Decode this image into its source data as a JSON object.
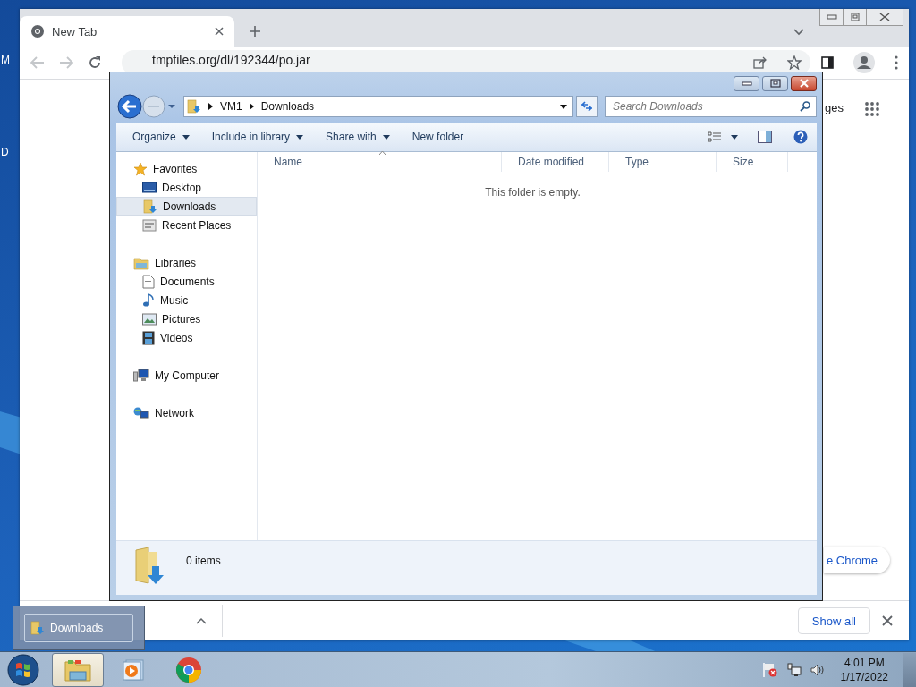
{
  "desktop": {
    "icon_labels": [
      "M",
      "D"
    ]
  },
  "browser": {
    "tabs": [
      {
        "title": "New Tab",
        "selected": true
      }
    ],
    "address": "tmpfiles.org/dl/192344/po.jar",
    "page": {
      "partial_link": "ges",
      "partial_button": "e Chrome"
    },
    "download_shelf": {
      "show_all": "Show all"
    }
  },
  "explorer": {
    "breadcrumb": [
      "VM1",
      "Downloads"
    ],
    "search": {
      "placeholder": "Search Downloads"
    },
    "commands": [
      {
        "label": "Organize",
        "dropdown": true
      },
      {
        "label": "Include in library",
        "dropdown": true
      },
      {
        "label": "Share with",
        "dropdown": true
      },
      {
        "label": "New folder",
        "dropdown": false
      }
    ],
    "nav": [
      {
        "label": "Favorites",
        "kind": "star",
        "children": [
          {
            "label": "Desktop",
            "kind": "desktop",
            "selected": false
          },
          {
            "label": "Downloads",
            "kind": "downloads",
            "selected": true
          },
          {
            "label": "Recent Places",
            "kind": "recent",
            "selected": false
          }
        ]
      },
      {
        "label": "Libraries",
        "kind": "libraries",
        "children": [
          {
            "label": "Documents",
            "kind": "document",
            "selected": false
          },
          {
            "label": "Music",
            "kind": "music",
            "selected": false
          },
          {
            "label": "Pictures",
            "kind": "pictures",
            "selected": false
          },
          {
            "label": "Videos",
            "kind": "videos",
            "selected": false
          }
        ]
      },
      {
        "label": "My Computer",
        "kind": "computer"
      },
      {
        "label": "Network",
        "kind": "network"
      }
    ],
    "columns": [
      {
        "label": "Name",
        "sorted": true
      },
      {
        "label": "Date modified",
        "sorted": false
      },
      {
        "label": "Type",
        "sorted": false
      },
      {
        "label": "Size",
        "sorted": false
      }
    ],
    "empty_message": "This folder is empty.",
    "status": "0 items"
  },
  "taskbar": {
    "buttons": [
      {
        "kind": "explorer",
        "selected": true
      },
      {
        "kind": "media",
        "selected": false
      },
      {
        "kind": "chrome",
        "selected": false
      }
    ],
    "thumbnail": {
      "title": "Downloads"
    },
    "clock": {
      "time": "4:01 PM",
      "date": "1/17/2022"
    }
  }
}
